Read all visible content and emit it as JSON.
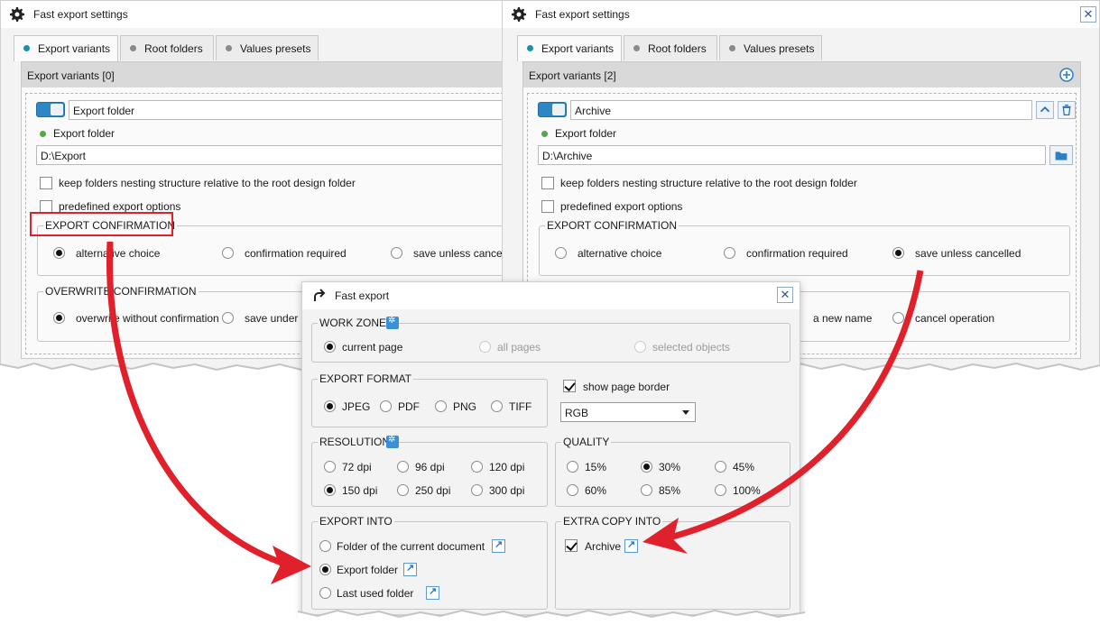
{
  "left_window": {
    "title": "Fast export settings",
    "tabs": [
      "Export variants",
      "Root folders",
      "Values presets"
    ],
    "panel_header": "Export variants",
    "count": "[0]",
    "variant_name": "Export folder",
    "folder_label": "Export folder",
    "folder_path": "D:\\Export",
    "keep_nesting": "keep folders nesting structure relative to the root design folder",
    "predefined": "predefined export options",
    "export_confirmation": {
      "title": "EXPORT CONFIRMATION",
      "options": [
        "alternative choice",
        "confirmation required",
        "save unless cancelled"
      ],
      "selected": "alternative choice"
    },
    "overwrite_confirmation": {
      "title": "OVERWRITE CONFIRMATION",
      "options": [
        "overwrite without confirmation",
        "save under a"
      ],
      "selected": "overwrite without confirmation"
    }
  },
  "right_window": {
    "title": "Fast export settings",
    "tabs": [
      "Export variants",
      "Root folders",
      "Values presets"
    ],
    "panel_header": "Export variants",
    "count": "[2]",
    "variant_name": "Archive",
    "folder_label": "Export folder",
    "folder_path": "D:\\Archive",
    "keep_nesting": "keep folders nesting structure relative to the root design folder",
    "predefined": "predefined export options",
    "export_confirmation": {
      "title": "EXPORT CONFIRMATION",
      "options": [
        "alternative choice",
        "confirmation required",
        "save unless cancelled"
      ],
      "selected": "save unless cancelled"
    },
    "overwrite_partial": [
      "a new name",
      "cancel operation"
    ]
  },
  "dialog": {
    "title": "Fast export",
    "work_zone": {
      "title": "WORK ZONE",
      "options": [
        "current page",
        "all pages",
        "selected objects"
      ],
      "selected": "current page"
    },
    "export_format": {
      "title": "EXPORT FORMAT",
      "options": [
        "JPEG",
        "PDF",
        "PNG",
        "TIFF"
      ],
      "selected": "JPEG"
    },
    "show_page_border": "show page border",
    "color_mode": "RGB",
    "resolution": {
      "title": "RESOLUTION",
      "options": [
        "72 dpi",
        "96 dpi",
        "120 dpi",
        "150 dpi",
        "250 dpi",
        "300 dpi"
      ],
      "selected": "150 dpi"
    },
    "quality": {
      "title": "QUALITY",
      "options": [
        "15%",
        "30%",
        "45%",
        "60%",
        "85%",
        "100%"
      ],
      "selected": "30%"
    },
    "export_into": {
      "title": "EXPORT INTO",
      "options": [
        "Folder of the current document",
        "Export folder",
        "Last used folder"
      ],
      "selected": "Export folder"
    },
    "extra_copy": {
      "title": "EXTRA COPY INTO",
      "item": "Archive",
      "checked": true
    }
  },
  "colors": {
    "accent": "#2c87c4",
    "highlight": "#e0202a",
    "arrow": "#e0202a"
  }
}
